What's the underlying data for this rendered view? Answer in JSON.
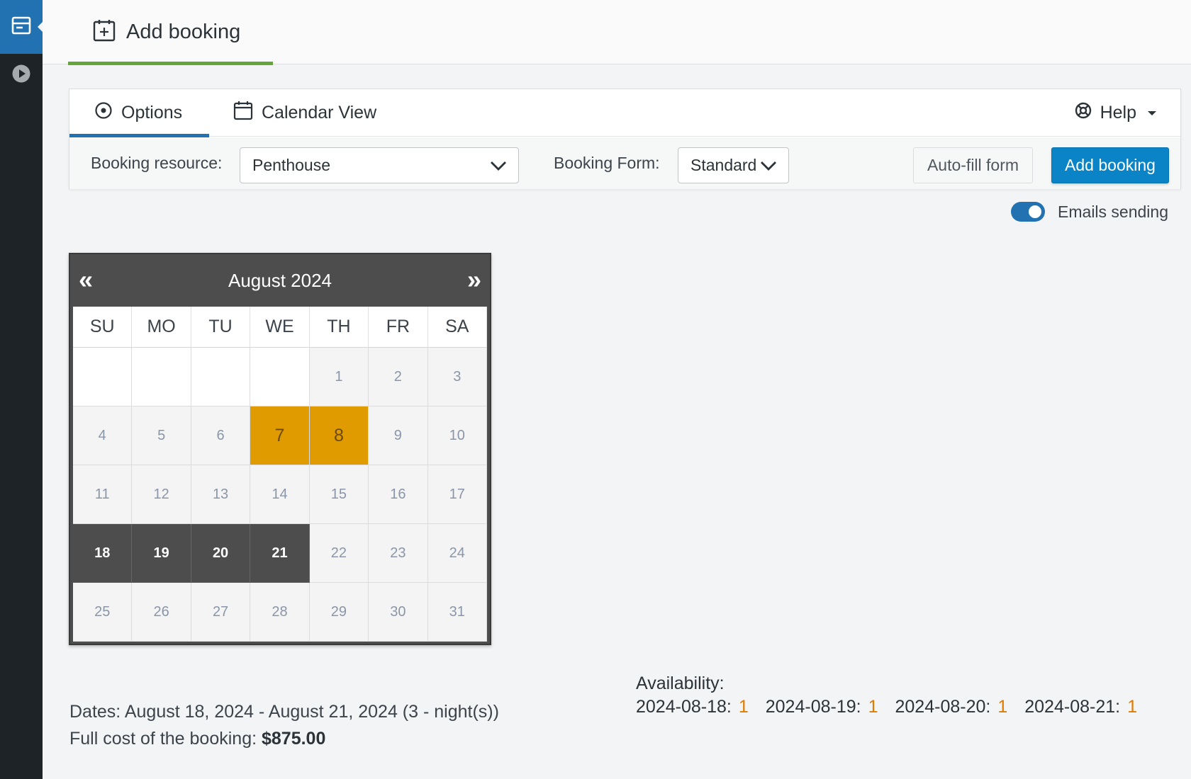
{
  "page": {
    "title": "Add booking"
  },
  "tabs": {
    "options": "Options",
    "calendar_view": "Calendar View",
    "help": "Help"
  },
  "toolbar": {
    "resource_label": "Booking resource:",
    "resource_value": "Penthouse",
    "form_label": "Booking Form:",
    "form_value": "Standard",
    "autofill_label": "Auto-fill form",
    "add_label": "Add booking"
  },
  "emails": {
    "label": "Emails sending",
    "enabled": true
  },
  "calendar": {
    "month": "August 2024",
    "prev": "«",
    "next": "»",
    "weekdays": [
      "SU",
      "MO",
      "TU",
      "WE",
      "TH",
      "FR",
      "SA"
    ],
    "first_weekday_index": 4,
    "days_in_month": 31,
    "booked_days": [
      7,
      8
    ],
    "selected_days": [
      18,
      19,
      20,
      21
    ]
  },
  "summary": {
    "dates_label": "Dates:",
    "dates_value": "August 18, 2024 - August 21, 2024 (3 - night(s))",
    "cost_label": "Full cost of the booking:",
    "cost_value": "$875.00"
  },
  "availability": {
    "title": "Availability:",
    "items": [
      {
        "date": "2024-08-18",
        "count": "1"
      },
      {
        "date": "2024-08-19",
        "count": "1"
      },
      {
        "date": "2024-08-20",
        "count": "1"
      },
      {
        "date": "2024-08-21",
        "count": "1"
      }
    ]
  },
  "colors": {
    "accent": "#2271b1",
    "primary_button": "#0a84c6",
    "booked": "#e09b00",
    "selected": "#4d4d4d",
    "tab_underline": "#64a63a",
    "availability_count": "#e07b00"
  }
}
